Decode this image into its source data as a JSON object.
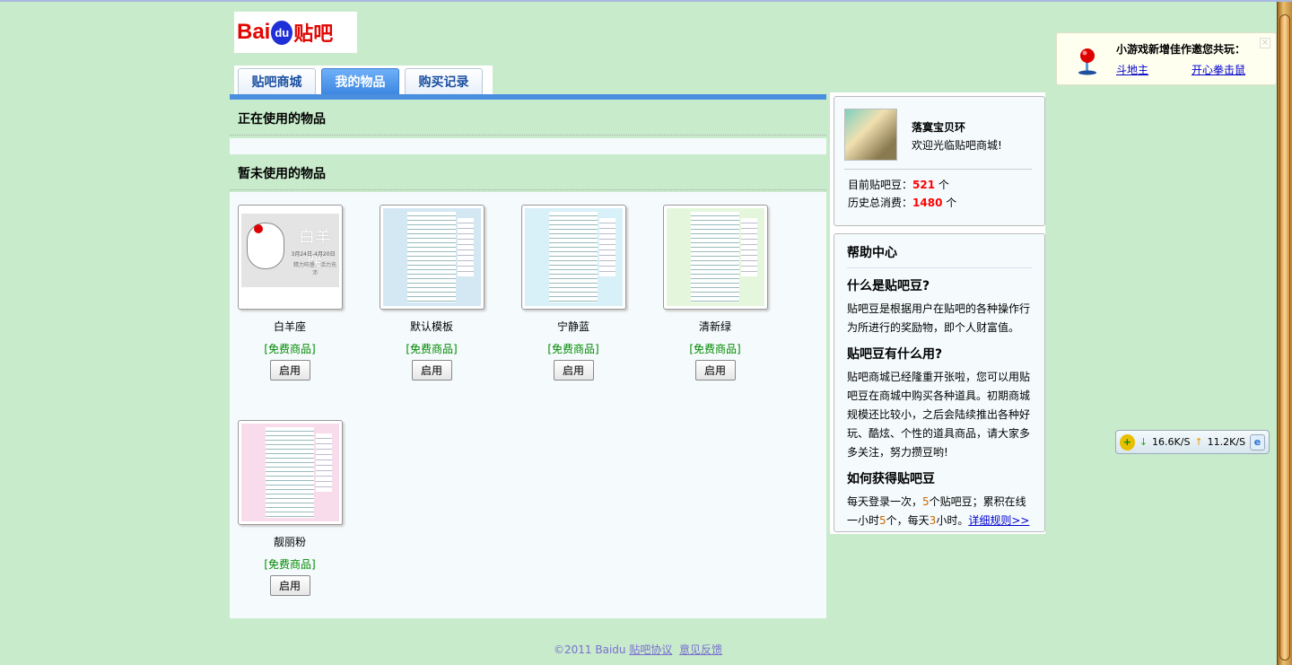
{
  "logo": {
    "text": "Baidu贴吧",
    "part1": "Bai",
    "part2": "du",
    "part3": "贴吧"
  },
  "tabs": [
    {
      "label": "贴吧商城"
    },
    {
      "label": "我的物品",
      "active": true
    },
    {
      "label": "购买记录"
    }
  ],
  "sections": {
    "in_use": "正在使用的物品",
    "unused": "暂未使用的物品"
  },
  "items": [
    {
      "name": "白羊座",
      "tag": "[免费商品]",
      "button": "启用",
      "thumb_text": "白羊座",
      "thumb_sub": "3月24日-4月20日",
      "thumb_sub2": "精力旺盛、活力充沛"
    },
    {
      "name": "默认模板",
      "tag": "[免费商品]",
      "button": "启用",
      "color": "#d4e8f4"
    },
    {
      "name": "宁静蓝",
      "tag": "[免费商品]",
      "button": "启用",
      "color": "#d8f0f8"
    },
    {
      "name": "清新绿",
      "tag": "[免费商品]",
      "button": "启用",
      "color": "#e4f6dc"
    },
    {
      "name": "靓丽粉",
      "tag": "[免费商品]",
      "button": "启用",
      "color": "#f8dcec"
    }
  ],
  "user": {
    "name": "落寞宝贝环",
    "welcome": "欢迎光临贴吧商城!",
    "beans_label": "目前贴吧豆：",
    "beans": "521",
    "unit": " 个",
    "spent_label": "历史总消费：",
    "spent": "1480"
  },
  "help": {
    "title": "帮助中心",
    "q1": "什么是贴吧豆?",
    "a1": "贴吧豆是根据用户在贴吧的各种操作行为所进行的奖励物，即个人财富值。",
    "q2": "贴吧豆有什么用?",
    "a2": "贴吧商城已经隆重开张啦，您可以用贴吧豆在商城中购买各种道具。初期商城规模还比较小，之后会陆续推出各种好玩、酷炫、个性的道具商品，请大家多多关注，努力攒豆哟!",
    "q3": "如何获得贴吧豆",
    "a3_1": "每天登录一次，",
    "a3_n1": "5",
    "a3_2": "个贴吧豆；累积在线一小时",
    "a3_n2": "5",
    "a3_3": "个，每天",
    "a3_n3": "3",
    "a3_4": "小时。",
    "link": "详细规则>>"
  },
  "popup": {
    "title": "小游戏新增佳作邀您共玩：",
    "links": [
      "斗地主",
      "开心拳击鼠"
    ],
    "close": "×"
  },
  "net": {
    "down": "16.6K/S",
    "up": "11.2K/S"
  },
  "footer": {
    "copyright": "©2011 Baidu",
    "links": [
      "贴吧协议",
      "意见反馈"
    ]
  },
  "colors": {
    "background": "#c8ebcb",
    "tab_active": "#4a8ee0",
    "free_tag": "#008800",
    "number": "#ff0000"
  }
}
